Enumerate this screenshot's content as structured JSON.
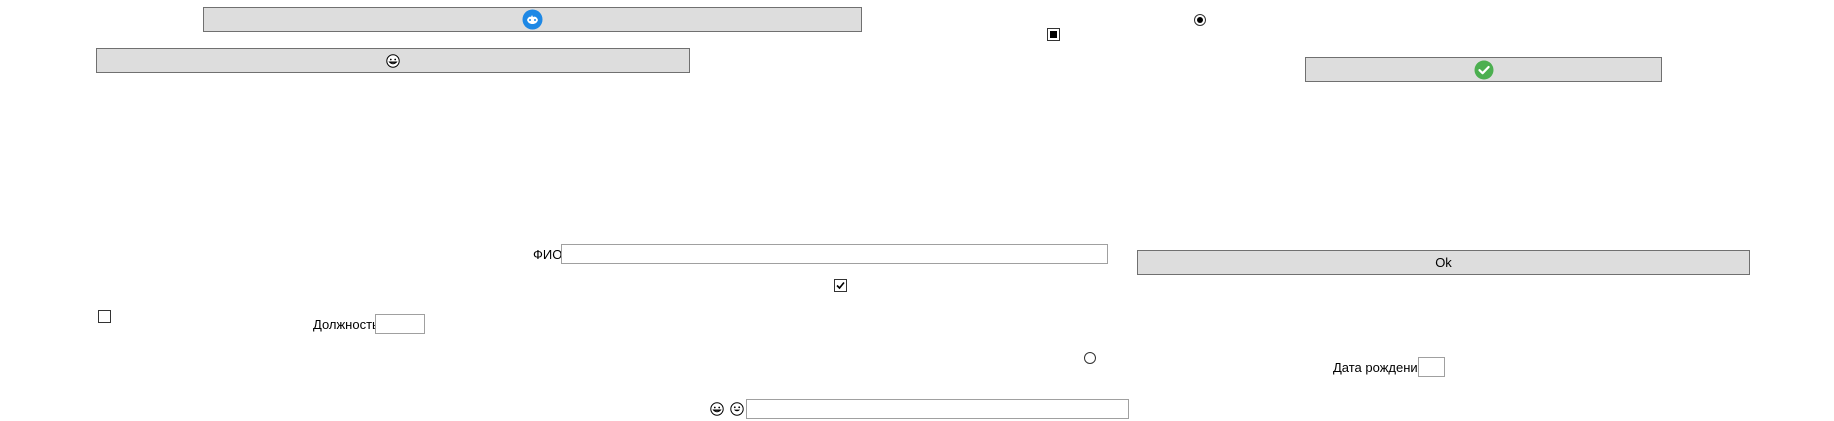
{
  "form": {
    "fio_label": "ФИО",
    "fio_value": "",
    "position_label": "Должность",
    "position_value": "",
    "birthdate_label": "Дата рождения",
    "birthdate_value": "",
    "emoji_field_value": "",
    "ok_label": "Ok"
  },
  "controls": {
    "checkbox_top_state": "indeterminate",
    "checkbox_middle_state": "checked",
    "checkbox_left_state": "unchecked",
    "radio_top_state": "selected",
    "radio_bottom_state": "unselected"
  },
  "icons": {
    "top_button_icon": "blue-circle-badge-icon",
    "second_button_icon": "grinning-face-icon",
    "right_button_icon": "green-check-circle-icon",
    "emoji_left": "grinning-face-icon",
    "emoji_right": "smiling-face-icon"
  },
  "colors": {
    "button_bg": "#dddddd",
    "blue_icon": "#1e88e5",
    "green_icon": "#4caf50"
  }
}
